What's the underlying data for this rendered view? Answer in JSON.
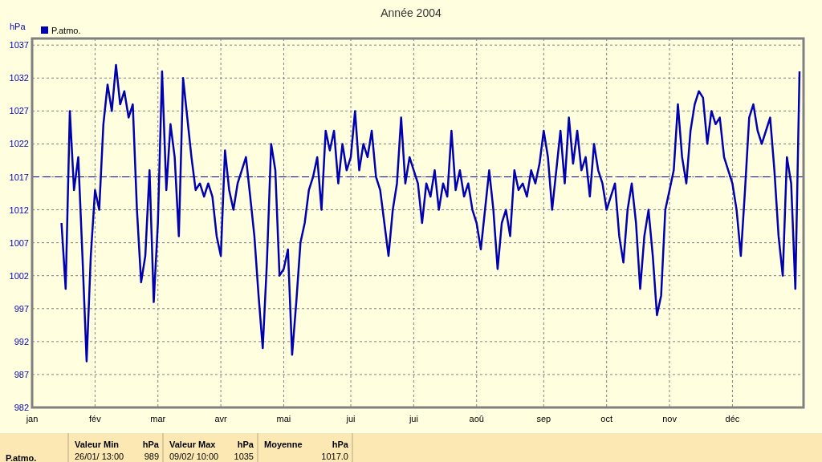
{
  "chart": {
    "chart_data": {
      "type": "line",
      "title": "Année 2004",
      "ylabel": "hPa",
      "ylim": [
        982,
        1038
      ],
      "yticks": [
        982,
        987,
        992,
        997,
        1002,
        1007,
        1012,
        1017,
        1022,
        1027,
        1032,
        1037
      ],
      "categories": [
        "jan",
        null,
        null,
        null,
        null,
        null,
        null,
        null,
        null,
        null,
        null,
        null,
        null,
        null,
        null,
        "fév",
        null,
        null,
        null,
        null,
        null,
        null,
        null,
        null,
        null,
        null,
        null,
        null,
        null,
        null,
        "mar",
        null,
        null,
        null,
        null,
        null,
        null,
        null,
        null,
        null,
        null,
        null,
        null,
        null,
        null,
        "avr",
        null,
        null,
        null,
        null,
        null,
        null,
        null,
        null,
        null,
        null,
        null,
        null,
        null,
        null,
        "mai",
        null,
        null,
        null,
        null,
        null,
        null,
        null,
        null,
        null,
        null,
        null,
        null,
        null,
        null,
        null,
        "jui",
        null,
        null,
        null,
        null,
        null,
        null,
        null,
        null,
        null,
        null,
        null,
        null,
        null,
        null,
        "jui",
        null,
        null,
        null,
        null,
        null,
        null,
        null,
        null,
        null,
        null,
        null,
        null,
        null,
        null,
        "aoû",
        null,
        null,
        null,
        null,
        null,
        null,
        null,
        null,
        null,
        null,
        null,
        null,
        null,
        null,
        null,
        "sep",
        null,
        null,
        null,
        null,
        null,
        null,
        null,
        null,
        null,
        null,
        null,
        null,
        null,
        null,
        "oct",
        null,
        null,
        null,
        null,
        null,
        null,
        null,
        null,
        null,
        null,
        null,
        null,
        null,
        null,
        "nov",
        null,
        null,
        null,
        null,
        null,
        null,
        null,
        null,
        null,
        null,
        null,
        null,
        null,
        null,
        "déc",
        null,
        null,
        null,
        null,
        null,
        null,
        null,
        null,
        null,
        null,
        null,
        null,
        null,
        null,
        null,
        null
      ],
      "series": [
        {
          "name": "P.atmo.",
          "color": "#0000b0",
          "values": [
            null,
            null,
            null,
            null,
            null,
            null,
            null,
            1010,
            1000,
            1027,
            1015,
            1020,
            1005,
            989,
            1005,
            1015,
            1012,
            1025,
            1031,
            1027,
            1034,
            1028,
            1030,
            1026,
            1028,
            1012,
            1001,
            1005,
            1018,
            998,
            1010,
            1033,
            1015,
            1025,
            1020,
            1008,
            1032,
            1026,
            1020,
            1015,
            1016,
            1014,
            1016,
            1014,
            1008,
            1005,
            1021,
            1015,
            1012,
            1016,
            1018,
            1020,
            1014,
            1008,
            999,
            991,
            1004,
            1022,
            1018,
            1002,
            1003,
            1006,
            990,
            998,
            1007,
            1010,
            1015,
            1017,
            1020,
            1012,
            1024,
            1021,
            1024,
            1016,
            1022,
            1018,
            1020,
            1027,
            1018,
            1022,
            1020,
            1024,
            1017,
            1015,
            1010,
            1005,
            1012,
            1016,
            1026,
            1016,
            1020,
            1018,
            1016,
            1010,
            1016,
            1014,
            1018,
            1012,
            1016,
            1014,
            1024,
            1015,
            1018,
            1014,
            1016,
            1012,
            1010,
            1006,
            1012,
            1018,
            1012,
            1003,
            1010,
            1012,
            1008,
            1018,
            1015,
            1016,
            1014,
            1018,
            1016,
            1019,
            1024,
            1020,
            1012,
            1018,
            1024,
            1016,
            1026,
            1019,
            1024,
            1018,
            1020,
            1014,
            1022,
            1018,
            1016,
            1012,
            1014,
            1016,
            1008,
            1004,
            1012,
            1016,
            1010,
            1000,
            1008,
            1012,
            1005,
            996,
            999,
            1012,
            1015,
            1018,
            1028,
            1020,
            1016,
            1024,
            1028,
            1030,
            1029,
            1022,
            1027,
            1025,
            1026,
            1020,
            1018,
            1016,
            1012,
            1005,
            1015,
            1026,
            1028,
            1024,
            1022,
            1024,
            1026,
            1018,
            1008,
            1002,
            1020,
            1016,
            1000,
            1033
          ]
        }
      ],
      "grid": true,
      "ref_lines": [
        {
          "axis": "y",
          "value": 1017
        }
      ]
    }
  },
  "stats": {
    "row_label": "P.atmo.",
    "columns": [
      {
        "heading": "Valeur Min",
        "unit": "hPa",
        "date": "26/01/ 13:00",
        "value": "989"
      },
      {
        "heading": "Valeur Max",
        "unit": "hPa",
        "date": "09/02/ 10:00",
        "value": "1035"
      },
      {
        "heading": "Moyenne",
        "unit": "hPa",
        "value": "1017.0"
      }
    ]
  }
}
